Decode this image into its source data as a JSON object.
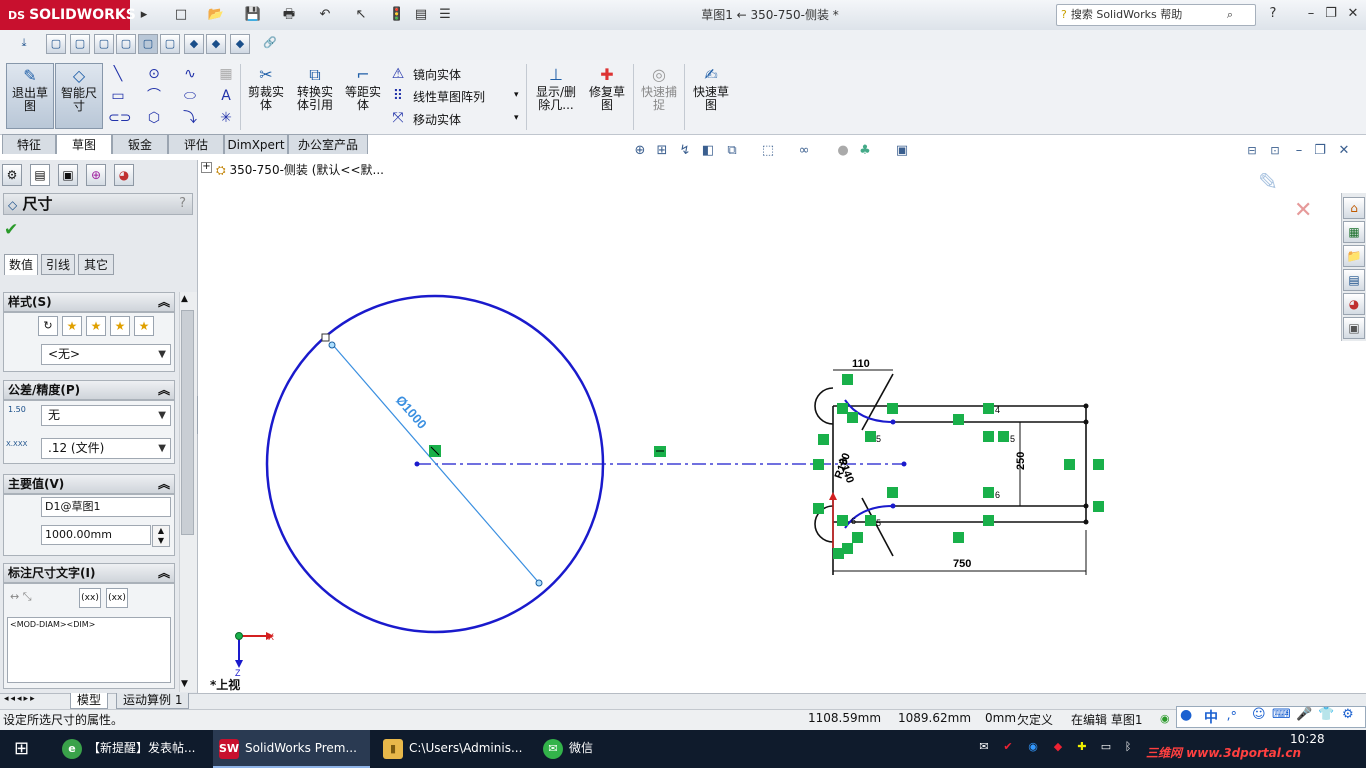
{
  "app": {
    "logo_text": "SOLIDWORKS",
    "logo_prefix": "DS",
    "doc_title": "草图1 ← 350-750-侧装 *",
    "help_search_placeholder": "搜索 SolidWorks 帮助"
  },
  "quick_access": [
    "new-icon",
    "open-icon",
    "save-icon",
    "print-icon",
    "undo-icon",
    "select-icon",
    "rebuild-icon",
    "file-props-icon",
    "options-icon"
  ],
  "command_manager": {
    "exit_sketch": "退出草图",
    "smart_dimension": "智能尺寸",
    "trim_entities": "剪裁实体",
    "convert_entities": "转换实体引用",
    "offset_entities": "等距实体",
    "mirror_entities": "镜向实体",
    "linear_pattern": "线性草图阵列",
    "move_entities": "移动实体",
    "display_delete": "显示/删除几...",
    "repair_sketch": "修复草图",
    "quick_snaps": "快速捕捉",
    "rapid_sketch": "快速草图"
  },
  "tabs": [
    "特征",
    "草图",
    "钣金",
    "评估",
    "DimXpert",
    "办公室产品"
  ],
  "active_tab": "草图",
  "tree": {
    "label": "350-750-侧装 (默认<<默..."
  },
  "property_manager": {
    "title": "尺寸",
    "help": "?",
    "subtabs": [
      "数值",
      "引线",
      "其它"
    ],
    "style_group": {
      "title": "样式(S)",
      "select_value": "<无>"
    },
    "tolerance_group": {
      "title": "公差/精度(P)",
      "tolerance_value": "无",
      "precision_value": ".12 (文件)",
      "tol_icon_text": "1.50",
      "prec_icon_text": "X.XXX"
    },
    "primary_group": {
      "title": "主要值(V)",
      "name_value": "D1@草图1",
      "dim_value": "1000.00mm"
    },
    "dimtext_group": {
      "title": "标注尺寸文字(I)",
      "text_value": "<MOD-DIAM><DIM>",
      "btn1": "(xx)",
      "btn2": "(xx)"
    }
  },
  "canvas": {
    "view_name": "*上视",
    "dims": {
      "diameter": "Ø1000",
      "d110": "110",
      "d250": "250",
      "d750": "750",
      "r140": "R140",
      "r150": "R150"
    },
    "relation_numbers": [
      "4",
      "5",
      "5",
      "5",
      "6",
      "6"
    ],
    "triad": {
      "x": "X",
      "z": "Z"
    }
  },
  "bottom_tabs": [
    "模型",
    "运动算例 1"
  ],
  "status": {
    "message": "设定所选尺寸的属性。",
    "x": "1108.59mm",
    "y": "1089.62mm",
    "z": "0mm",
    "state": "欠定义",
    "editing": "在编辑 草图1"
  },
  "taskbar": {
    "items": [
      {
        "label": "【新提醒】发表帖...",
        "color": "#3aa24a",
        "glyph": "e"
      },
      {
        "label": "SolidWorks Prem...",
        "color": "#c8102e",
        "glyph": "SW"
      },
      {
        "label": "C:\\Users\\Adminis...",
        "color": "#e8b84a",
        "glyph": "▮"
      },
      {
        "label": "微信",
        "color": "#33b34a",
        "glyph": "✉"
      }
    ],
    "clock": "10:28",
    "ime_cn": "中",
    "watermark": "三维网 www.3dportal.cn"
  },
  "colors": {
    "sketch_blue": "#1a1acc",
    "dimension_blue": "#3a8fe0",
    "relation_green": "#19b04a",
    "logo_red": "#c8102e"
  }
}
